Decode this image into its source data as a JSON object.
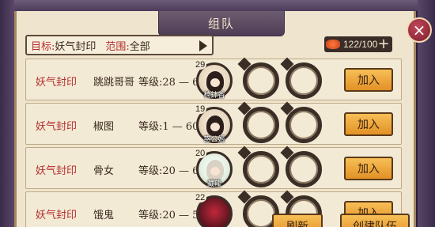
{
  "header": {
    "title": "组队"
  },
  "filter": {
    "target_label": "目标:",
    "target_value": "妖气封印",
    "range_label": "范围:",
    "range_value": "全部"
  },
  "stamina": {
    "value": "122/100",
    "plus_label": "+"
  },
  "close": {
    "label": "×"
  },
  "teams": [
    {
      "name": "妖气封印",
      "leader": "跳跳哥哥",
      "level": "等级:28 — 60",
      "avatar_level": "29",
      "avatar_name": "椅鉢香",
      "join_label": "加入"
    },
    {
      "name": "妖气封印",
      "leader": "椒图",
      "level": "等级:1 — 60",
      "avatar_level": "19",
      "avatar_name": "惑公姬",
      "join_label": "加入"
    },
    {
      "name": "妖气封印",
      "leader": "骨女",
      "level": "等级:20 — 60",
      "avatar_level": "20",
      "avatar_name": "藏龍",
      "join_label": "加入"
    },
    {
      "name": "妖气封印",
      "leader": "饿鬼",
      "level": "等级:20 — 53",
      "avatar_level": "22",
      "avatar_name": "",
      "join_label": "加入"
    }
  ],
  "footer": {
    "refresh_label": "刷新",
    "create_label": "创建队伍"
  }
}
